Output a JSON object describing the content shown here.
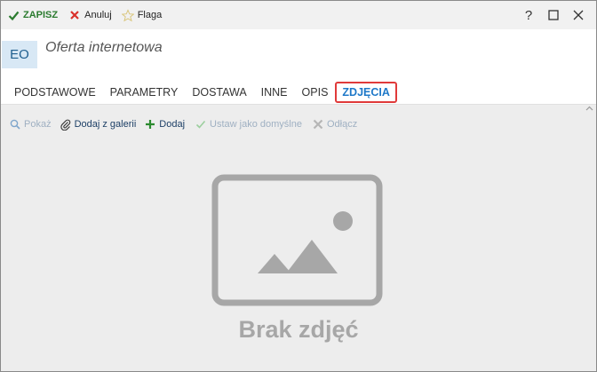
{
  "toolbar": {
    "save_label": "ZAPISZ",
    "cancel_label": "Anuluj",
    "flag_label": "Flaga"
  },
  "window_controls": {
    "help": "?",
    "maximize": "☐",
    "close": "✕"
  },
  "header": {
    "avatar_initials": "EO",
    "title": "Oferta internetowa"
  },
  "tabs": [
    {
      "label": "PODSTAWOWE"
    },
    {
      "label": "PARAMETRY"
    },
    {
      "label": "DOSTAWA"
    },
    {
      "label": "INNE"
    },
    {
      "label": "OPIS"
    },
    {
      "label": "ZDJĘCIA",
      "active": true
    }
  ],
  "photo_toolbar": {
    "show_label": "Pokaż",
    "add_from_gallery_label": "Dodaj z galerii",
    "add_label": "Dodaj",
    "set_default_label": "Ustaw jako domyślne",
    "detach_label": "Odłącz"
  },
  "empty_state": {
    "label": "Brak zdjęć",
    "icon": "image-placeholder-icon"
  },
  "colors": {
    "accent": "#1e78c8",
    "save_green": "#2b7b2f",
    "cancel_red": "#d9302a",
    "active_tab_border": "#e03a3a",
    "empty_gray": "#a7a7a7"
  }
}
